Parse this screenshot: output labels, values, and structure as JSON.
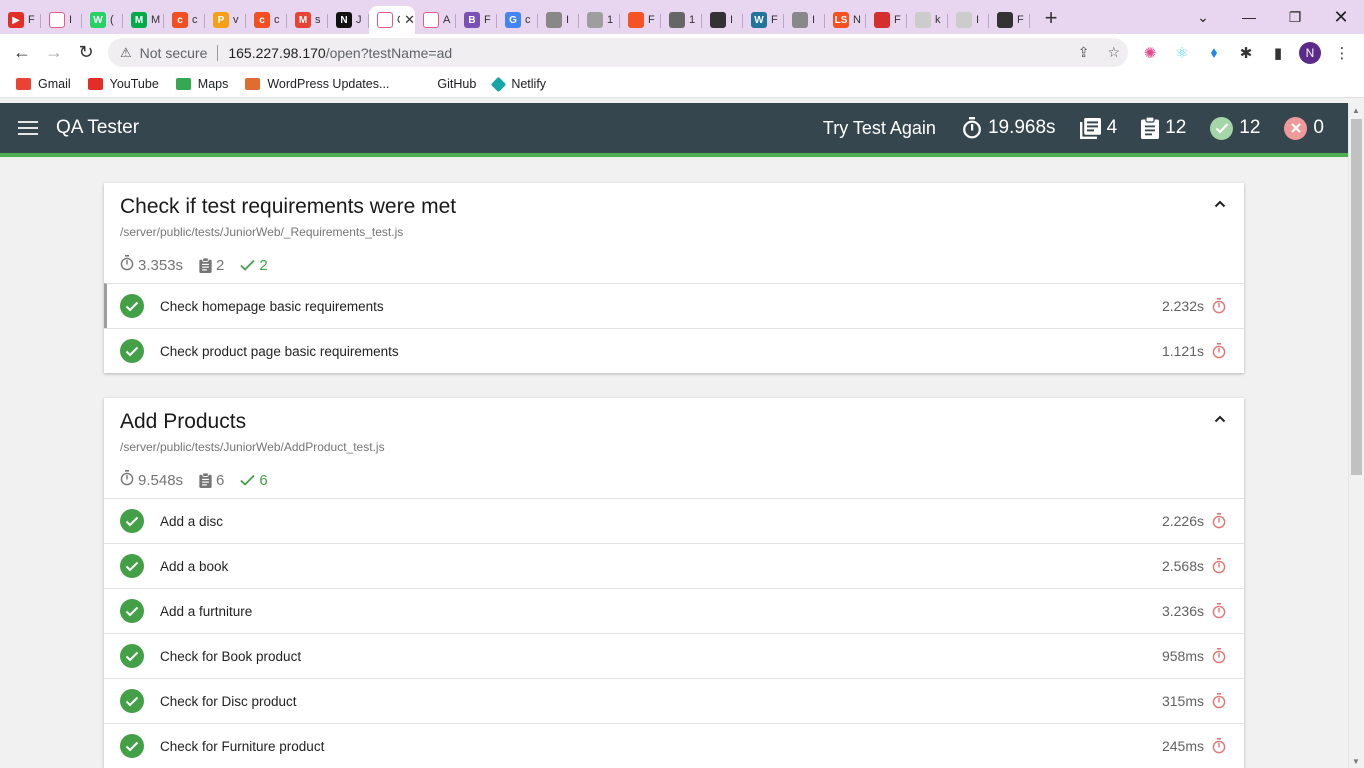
{
  "browser": {
    "tabs": [
      {
        "icon": "youtube-icon",
        "color": "#e52d27",
        "letter": "▶",
        "title": "F"
      },
      {
        "icon": "laravel-icon",
        "color": "#ffffff",
        "letter": "",
        "title": "I"
      },
      {
        "icon": "whatsapp-icon",
        "color": "#25d366",
        "letter": "W",
        "title": "("
      },
      {
        "icon": "meet-icon",
        "color": "#00ac47",
        "letter": "M",
        "title": "M"
      },
      {
        "icon": "codepen-icon",
        "color": "#f25022",
        "letter": "c",
        "title": "c"
      },
      {
        "icon": "pma-icon",
        "color": "#f6a018",
        "letter": "P",
        "title": "v"
      },
      {
        "icon": "codepen-icon",
        "color": "#f25022",
        "letter": "c",
        "title": "c"
      },
      {
        "icon": "gmail-icon",
        "color": "#ea4335",
        "letter": "M",
        "title": "s"
      },
      {
        "icon": "notion-icon",
        "color": "#111111",
        "letter": "N",
        "title": "J"
      },
      {
        "icon": "qa-icon",
        "color": "#ffffff",
        "letter": "",
        "title": "Q",
        "active": true
      },
      {
        "icon": "laravel-icon",
        "color": "#ffffff",
        "letter": "",
        "title": "A"
      },
      {
        "icon": "bootstrap-icon",
        "color": "#7952b3",
        "letter": "B",
        "title": "F"
      },
      {
        "icon": "google-icon",
        "color": "#4285f4",
        "letter": "G",
        "title": "c"
      },
      {
        "icon": "mountain-icon",
        "color": "#888888",
        "letter": "",
        "title": "I"
      },
      {
        "icon": "globe-icon",
        "color": "#9e9e9e",
        "letter": "",
        "title": "1"
      },
      {
        "icon": "microsoft-icon",
        "color": "#f35325",
        "letter": "",
        "title": "F"
      },
      {
        "icon": "box-icon",
        "color": "#666666",
        "letter": "",
        "title": "1"
      },
      {
        "icon": "github-icon",
        "color": "#333333",
        "letter": "",
        "title": "I"
      },
      {
        "icon": "wordpress-icon",
        "color": "#21759b",
        "letter": "W",
        "title": "F"
      },
      {
        "icon": "mountain-icon",
        "color": "#888888",
        "letter": "",
        "title": "I"
      },
      {
        "icon": "ls-icon",
        "color": "#f4511e",
        "letter": "LS",
        "title": "N"
      },
      {
        "icon": "leaf-icon",
        "color": "#d32f2f",
        "letter": "",
        "title": "F"
      },
      {
        "icon": "github-icon",
        "color": "#cccccc",
        "letter": "",
        "title": "k"
      },
      {
        "icon": "github-icon",
        "color": "#cccccc",
        "letter": "",
        "title": "I"
      },
      {
        "icon": "chrome-icon",
        "color": "#333333",
        "letter": "",
        "title": "F"
      }
    ],
    "address": {
      "security_label": "Not secure",
      "host": "165.227.98.170",
      "path": "/open?testName=ad"
    },
    "profile_initial": "N",
    "bookmarks": [
      {
        "label": "Gmail",
        "icon": "gmail-icon",
        "color": "#ea4335"
      },
      {
        "label": "YouTube",
        "icon": "youtube-icon",
        "color": "#e52d27"
      },
      {
        "label": "Maps",
        "icon": "maps-icon",
        "color": "#34a853"
      },
      {
        "label": "WordPress Updates...",
        "icon": "wordpress-icon",
        "color": "#e06c2f"
      },
      {
        "label": "GitHub",
        "icon": "github-icon",
        "color": ""
      },
      {
        "label": "Netlify",
        "icon": "netlify-icon",
        "color": "#15a7a7"
      }
    ]
  },
  "app": {
    "title": "QA Tester",
    "try_again_label": "Try Test Again",
    "total_time": "19.968s",
    "suites_count": "4",
    "tests_count": "12",
    "passed_count": "12",
    "failed_count": "0",
    "colors": {
      "appbar": "#36464f",
      "accent": "#4caf50",
      "pass": "#43a047",
      "fail": "#e57373",
      "timer": "#e57373"
    }
  },
  "suites": [
    {
      "title": "Check if test requirements were met",
      "path": "/server/public/tests/JuniorWeb/_Requirements_test.js",
      "time": "3.353s",
      "count": "2",
      "passed": "2",
      "tests": [
        {
          "label": "Check homepage basic requirements",
          "time": "2.232s"
        },
        {
          "label": "Check product page basic requirements",
          "time": "1.121s"
        }
      ]
    },
    {
      "title": "Add Products",
      "path": "/server/public/tests/JuniorWeb/AddProduct_test.js",
      "time": "9.548s",
      "count": "6",
      "passed": "6",
      "tests": [
        {
          "label": "Add a disc",
          "time": "2.226s"
        },
        {
          "label": "Add a book",
          "time": "2.568s"
        },
        {
          "label": "Add a furtniture",
          "time": "3.236s"
        },
        {
          "label": "Check for Book product",
          "time": "958ms"
        },
        {
          "label": "Check for Disc product",
          "time": "315ms"
        },
        {
          "label": "Check for Furniture product",
          "time": "245ms"
        }
      ]
    }
  ]
}
